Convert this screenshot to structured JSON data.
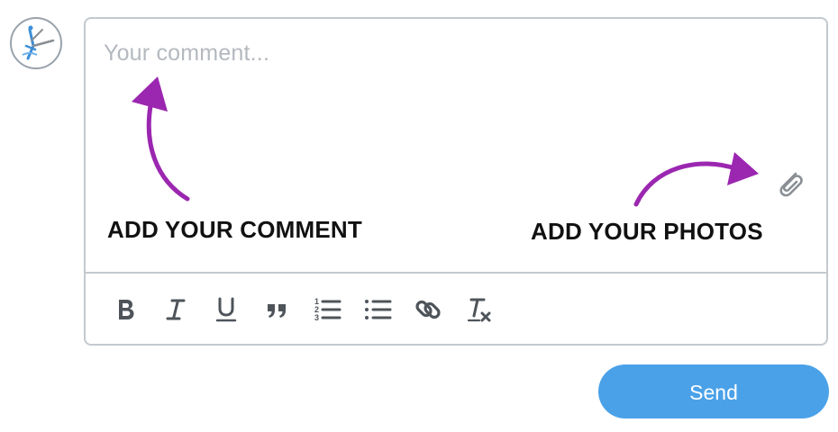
{
  "comment": {
    "placeholder": "Your comment..."
  },
  "annotations": {
    "comment_hint": "ADD YOUR COMMENT",
    "photos_hint": "ADD YOUR PHOTOS",
    "arrow_color": "#9b27b0"
  },
  "toolbar": {
    "items": [
      {
        "name": "bold",
        "icon": "bold-icon"
      },
      {
        "name": "italic",
        "icon": "italic-icon"
      },
      {
        "name": "underline",
        "icon": "underline-icon"
      },
      {
        "name": "blockquote",
        "icon": "quote-icon"
      },
      {
        "name": "ordered-list",
        "icon": "ordered-list-icon"
      },
      {
        "name": "bullet-list",
        "icon": "bullet-list-icon"
      },
      {
        "name": "link",
        "icon": "link-icon"
      },
      {
        "name": "clear-format",
        "icon": "clear-format-icon"
      }
    ]
  },
  "attachment": {
    "icon": "paperclip-icon"
  },
  "send": {
    "label": "Send",
    "color": "#4aa1e8"
  },
  "colors": {
    "border": "#c4c9ce",
    "placeholder": "#b4b9bf",
    "icon": "#555b61"
  }
}
